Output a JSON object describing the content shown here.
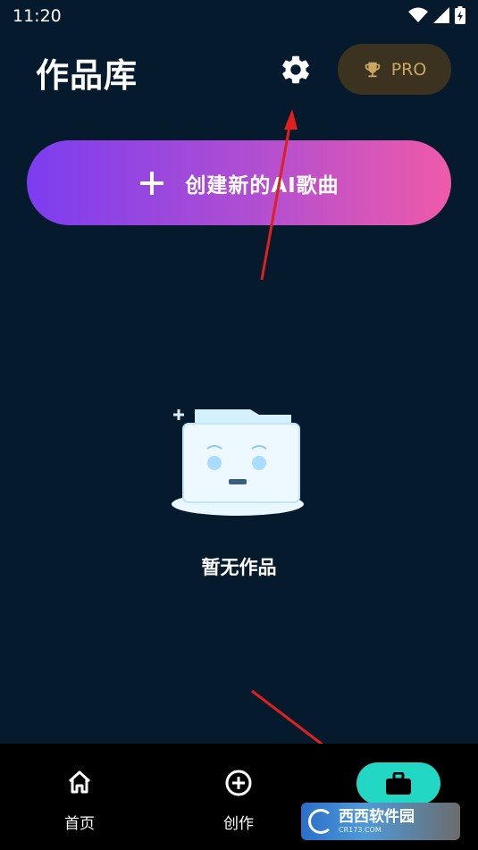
{
  "status_bar": {
    "time": "11:20"
  },
  "header": {
    "title": "作品库",
    "pro_label": "PRO"
  },
  "create_button": {
    "label": "创建新的AI歌曲"
  },
  "empty_state": {
    "text": "暂无作品"
  },
  "bottom_nav": {
    "items": [
      {
        "label": "首页",
        "icon": "home-icon"
      },
      {
        "label": "创作",
        "icon": "plus-circle-icon"
      },
      {
        "label": "",
        "icon": "briefcase-icon",
        "active": true
      }
    ]
  },
  "watermark": {
    "text": "西西软件园",
    "sub": "CR173.COM"
  },
  "colors": {
    "background": "#061a2e",
    "pro_bg": "#3b3220",
    "pro_text": "#c9a760",
    "gradient_start": "#7c3df0",
    "gradient_end": "#ef5aa9",
    "active_tab": "#22d8c4",
    "annotation_arrow": "#e0201c"
  }
}
